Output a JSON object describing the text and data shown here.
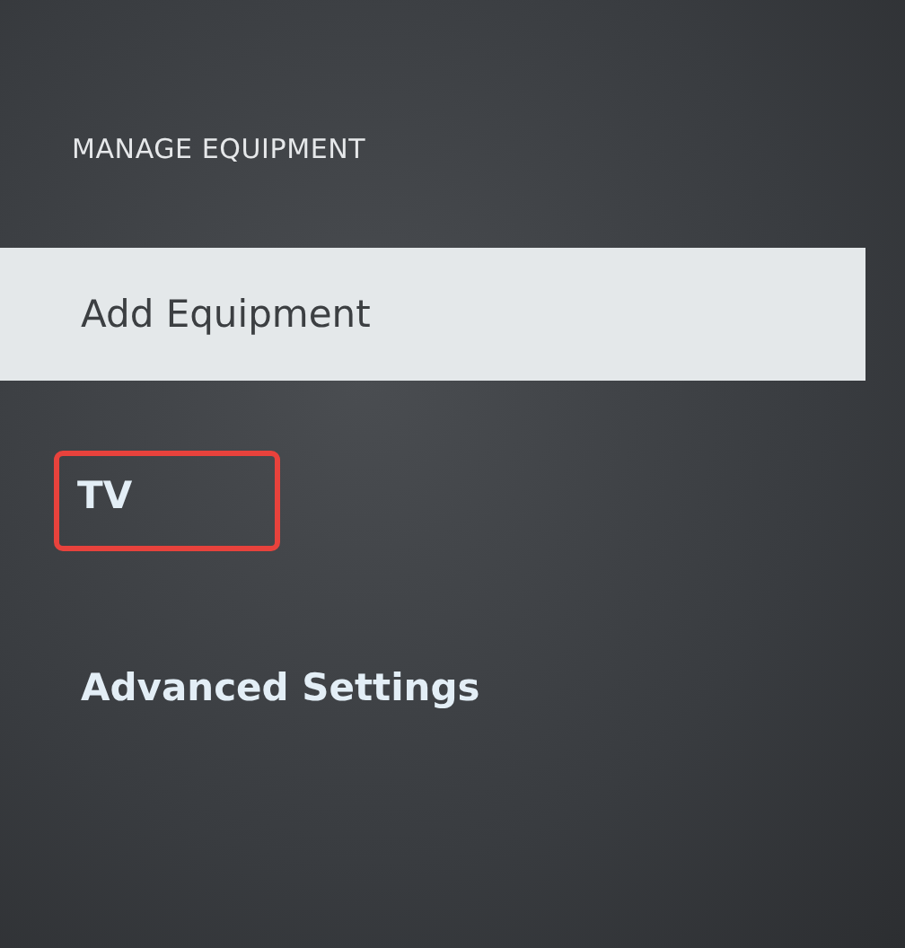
{
  "section_title": "MANAGE EQUIPMENT",
  "items": [
    {
      "label": "Add Equipment",
      "selected": true,
      "highlighted": false
    },
    {
      "label": "TV",
      "selected": false,
      "highlighted": true
    },
    {
      "label": "Advanced Settings",
      "selected": false,
      "highlighted": false
    }
  ]
}
